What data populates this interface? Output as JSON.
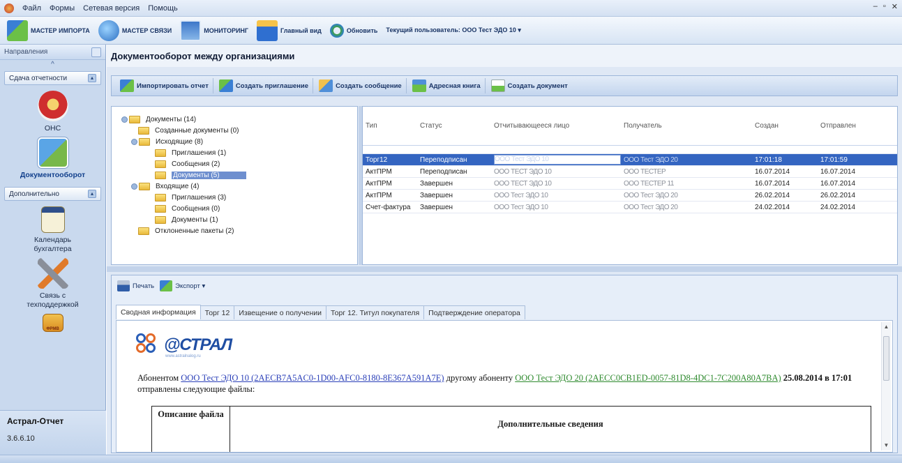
{
  "menu": {
    "items": [
      "Файл",
      "Формы",
      "Сетевая версия",
      "Помощь"
    ],
    "window_controls": [
      "‒",
      "▫",
      "✕"
    ]
  },
  "toolbar": {
    "import_wizard": "МАСТЕР ИМПОРТА",
    "link_wizard": "МАСТЕР СВЯЗИ",
    "monitoring": "МОНИТОРИНГ",
    "main_view": "Главный вид",
    "refresh": "Обновить",
    "current_user": "Текущий пользователь: ООО Тест ЭДО 10 ▾"
  },
  "sidebar": {
    "header": "Направления",
    "group1": "Сдача отчетности",
    "item_ons": "ОНС",
    "item_docflow": "Документооборот",
    "group2": "Дополнительно",
    "item_calendar": "Календарь бухгалтера",
    "item_support": "Связь с техподдержкой",
    "fpms_label": "ФРМВ",
    "app_name": "Астрал-Отчет",
    "version": "3.6.6.10"
  },
  "page": {
    "title": "Документооборот между организациями"
  },
  "actions": {
    "import_report": "Импортировать отчет",
    "create_invite": "Создать приглашение",
    "create_message": "Создать сообщение",
    "address_book": "Адресная книга",
    "create_document": "Создать документ"
  },
  "tree": {
    "root": "Документы (14)",
    "created": "Созданные документы (0)",
    "outgoing": "Исходящие (8)",
    "out_invites": "Приглашения (1)",
    "out_messages": "Сообщения (2)",
    "out_documents": "Документы (5)",
    "incoming": "Входящие (4)",
    "in_invites": "Приглашения (3)",
    "in_messages": "Сообщения (0)",
    "in_documents": "Документы (1)",
    "rejected": "Отклоненные пакеты (2)"
  },
  "grid": {
    "columns": [
      "Тип",
      "Статус",
      "Отчитывающееся лицо",
      "Получатель",
      "Создан",
      "Отправлен"
    ],
    "rows": [
      {
        "type": "Торг12",
        "status": "Переподписан",
        "reporter": "ООО Тест ЭДО 10",
        "recipient": "ООО Тест ЭДО 20",
        "created": "17:01:18",
        "sent": "17:01:59"
      },
      {
        "type": "АктПРМ",
        "status": "Переподписан",
        "reporter": "ООО ТЕСТ ЭДО 10",
        "recipient": "ООО ТЕСТЕР",
        "created": "16.07.2014",
        "sent": "16.07.2014"
      },
      {
        "type": "АктПРМ",
        "status": "Завершен",
        "reporter": "ООО ТЕСТ ЭДО 10",
        "recipient": "ООО ТЕСТЕР 11",
        "created": "16.07.2014",
        "sent": "16.07.2014"
      },
      {
        "type": "АктПРМ",
        "status": "Завершен",
        "reporter": "ООО Тест ЭДО 10",
        "recipient": "ООО Тест ЭДО 20",
        "created": "26.02.2014",
        "sent": "26.02.2014"
      },
      {
        "type": "Счет-фактура",
        "status": "Завершен",
        "reporter": "ООО Тест ЭДО 10",
        "recipient": "ООО Тест ЭДО 20",
        "created": "24.02.2014",
        "sent": "24.02.2014"
      }
    ]
  },
  "bottom": {
    "print": "Печать",
    "export": "Экспорт ▾",
    "tabs": [
      "Сводная информация",
      "Торг 12",
      "Извещение о получении",
      "Торг 12. Титул покупателя",
      "Подтверждение оператора"
    ],
    "logo_word": "@СТРАЛ",
    "logo_site": "www.astralnalog.ru",
    "para_prefix": "Абонентом",
    "sender": "ООО Тест ЭДО 10 (2AECB7A5AC0-1D00-AFC0-8180-8E367A591A7E)",
    "para_mid": "другому абоненту",
    "receiver": "ООО Тест ЭДО 20 (2AECC0CB1ED-0057-81D8-4DC1-7C200A80A7BA)",
    "date_text": "25.08.2014 в 17:01",
    "para_suffix": "отправлены следующие файлы:",
    "col_description": "Описание файла",
    "col_additional": "Дополнительные сведения"
  }
}
